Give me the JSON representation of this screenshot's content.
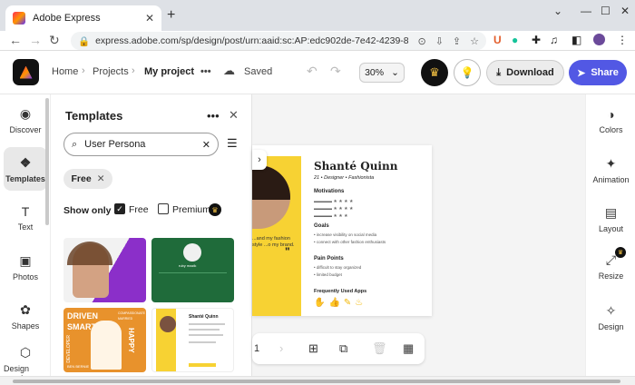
{
  "browser": {
    "tab_title": "Adobe Express",
    "tab_close": "✕",
    "new_tab": "+",
    "url": "express.adobe.com/sp/design/post/urn:aaid:sc:AP:edc902de-7e42-4239-82..."
  },
  "header": {
    "breadcrumb_home": "Home",
    "breadcrumb_projects": "Projects",
    "breadcrumb_current": "My project",
    "more": "•••",
    "saved": "Saved",
    "zoom": "30%",
    "download": "Download",
    "share": "Share"
  },
  "left_rail": [
    {
      "label": "Discover",
      "icon": "discover-icon",
      "glyph": "◉"
    },
    {
      "label": "Templates",
      "icon": "templates-icon",
      "glyph": "❖"
    },
    {
      "label": "Text",
      "icon": "text-icon",
      "glyph": "T"
    },
    {
      "label": "Photos",
      "icon": "photos-icon",
      "glyph": "▣"
    },
    {
      "label": "Shapes",
      "icon": "shapes-icon",
      "glyph": "✿"
    },
    {
      "label": "Design assets",
      "icon": "design-assets-icon",
      "glyph": "⬡"
    }
  ],
  "panel": {
    "title": "Templates",
    "more": "•••",
    "close": "✕",
    "search_value": "User Persona",
    "chip": "Free",
    "show_only": "Show only :",
    "free_label": "Free",
    "premium_label": "Premium",
    "free_checked": true,
    "premium_checked": false
  },
  "thumb_text": {
    "green_tag": "ruby mazik",
    "green_line": "ruby mazik",
    "orange_words": [
      "DRIVEN",
      "SMART",
      "DEVELOPER",
      "HAPPY"
    ],
    "orange_extra": "COMPASSIONATE",
    "orange_small": "MARRIED",
    "orange_foot": "BEN BERNIE",
    "persona_title": "Shanté Quinn"
  },
  "canvas": {
    "name": "Shanté Quinn",
    "subtitle": "21 • Designer • Fashionista",
    "motivations": "Motivations",
    "goals": "Goals",
    "goal1": "• increase visibility on social media",
    "goal2": "• connect with other fashion enthusiasts",
    "pain": "Pain Points",
    "pain1": "• difficult to stay organized",
    "pain2": "• limited budget",
    "apps": "Frequently Used Apps",
    "quote": "...and my fashion style ...o my brand.",
    "page_num": "1"
  },
  "right_rail": [
    {
      "label": "Colors",
      "icon": "colors-icon",
      "glyph": "◑"
    },
    {
      "label": "Animation",
      "icon": "animation-icon",
      "glyph": "✦"
    },
    {
      "label": "Layout",
      "icon": "layout-icon",
      "glyph": "▤"
    },
    {
      "label": "Resize",
      "icon": "resize-icon",
      "glyph": "⤢"
    },
    {
      "label": "Design",
      "icon": "design-icon",
      "glyph": "✧"
    }
  ],
  "colors": {
    "accent": "#5258e4",
    "yellow": "#f7d233",
    "green": "#1f6b3a",
    "purple": "#7b1fa2"
  }
}
